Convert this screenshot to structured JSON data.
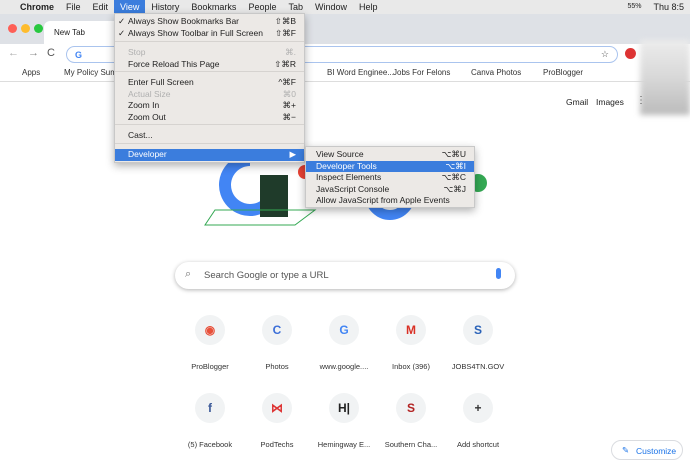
{
  "menubar": {
    "items": [
      "Chrome",
      "File",
      "Edit",
      "View",
      "History",
      "Bookmarks",
      "People",
      "Tab",
      "Window",
      "Help"
    ],
    "active": "View",
    "status": {
      "battery": "55%",
      "clock": "Thu 8:5"
    }
  },
  "tab": {
    "title": "New Tab"
  },
  "omnibox": {
    "value": "G"
  },
  "bookmarks": [
    "Apps",
    "My Policy Sum",
    "BI Word Enginee...",
    "Jobs For Felons",
    "Canva Photos",
    "ProBlogger"
  ],
  "header_links": {
    "gmail": "Gmail",
    "images": "Images"
  },
  "view_menu": [
    {
      "label": "Always Show Bookmarks Bar",
      "shortcut": "⇧⌘B",
      "checked": true
    },
    {
      "label": "Always Show Toolbar in Full Screen",
      "shortcut": "⇧⌘F",
      "checked": true
    },
    {
      "label": "Stop",
      "shortcut": "⌘.",
      "disabled": true
    },
    {
      "label": "Force Reload This Page",
      "shortcut": "⇧⌘R"
    },
    {
      "label": "Enter Full Screen",
      "shortcut": "^⌘F"
    },
    {
      "label": "Actual Size",
      "shortcut": "⌘0",
      "disabled": true
    },
    {
      "label": "Zoom In",
      "shortcut": "⌘+"
    },
    {
      "label": "Zoom Out",
      "shortcut": "⌘−"
    },
    {
      "label": "Cast...",
      "shortcut": ""
    },
    {
      "label": "Developer",
      "shortcut": "▶",
      "highlighted": true
    }
  ],
  "developer_menu": [
    {
      "label": "View Source",
      "shortcut": "⌥⌘U"
    },
    {
      "label": "Developer Tools",
      "shortcut": "⌥⌘I",
      "highlighted": true
    },
    {
      "label": "Inspect Elements",
      "shortcut": "⌥⌘C"
    },
    {
      "label": "JavaScript Console",
      "shortcut": "⌥⌘J"
    },
    {
      "label": "Allow JavaScript from Apple Events",
      "shortcut": ""
    }
  ],
  "search": {
    "placeholder": "Search Google or type a URL"
  },
  "shortcuts": [
    {
      "label": "ProBlogger",
      "glyph": "◉",
      "color": "#e8503a"
    },
    {
      "label": "Photos",
      "glyph": "C",
      "color": "#3c6fd8"
    },
    {
      "label": "www.google....",
      "glyph": "G",
      "color": "#4285f4"
    },
    {
      "label": "Inbox (396)",
      "glyph": "M",
      "color": "#d93025"
    },
    {
      "label": "JOBS4TN.GOV",
      "glyph": "S",
      "color": "#2a62b8"
    },
    {
      "label": "(5) Facebook",
      "glyph": "f",
      "color": "#3b5998"
    },
    {
      "label": "PodTechs",
      "glyph": "⋈",
      "color": "#d33"
    },
    {
      "label": "Hemingway E...",
      "glyph": "H|",
      "color": "#222"
    },
    {
      "label": "Southern Cha...",
      "glyph": "S",
      "color": "#b22222"
    },
    {
      "label": "Add shortcut",
      "glyph": "+",
      "color": "#333"
    }
  ],
  "customize": {
    "label": "Customize"
  }
}
